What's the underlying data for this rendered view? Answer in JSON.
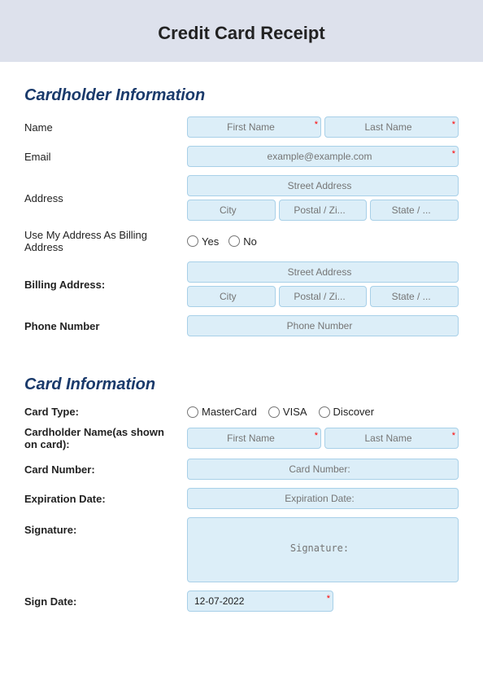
{
  "header": {
    "title": "Credit Card Receipt"
  },
  "cardholder_section": {
    "title": "Cardholder Information",
    "fields": {
      "name_label": "Name",
      "first_name_placeholder": "First Name",
      "last_name_placeholder": "Last Name",
      "email_label": "Email",
      "email_placeholder": "example@example.com",
      "address_label": "Address",
      "street_placeholder": "Street Address",
      "city_placeholder": "City",
      "postal_placeholder": "Postal / Zi...",
      "state_placeholder": "State / ...",
      "use_billing_label": "Use My Address As Billing Address",
      "yes_label": "Yes",
      "no_label": "No",
      "billing_label": "Billing Address:",
      "billing_street_placeholder": "Street Address",
      "billing_city_placeholder": "City",
      "billing_postal_placeholder": "Postal / Zi...",
      "billing_state_placeholder": "State / ...",
      "phone_label": "Phone Number",
      "phone_placeholder": "Phone Number"
    }
  },
  "card_section": {
    "title": "Card Information",
    "fields": {
      "card_type_label": "Card Type:",
      "card_options": [
        "MasterCard",
        "VISA",
        "Discover"
      ],
      "cardholder_name_label": "Cardholder Name(as shown on card):",
      "card_first_name_placeholder": "First Name",
      "card_last_name_placeholder": "Last Name",
      "card_number_label": "Card Number:",
      "card_number_placeholder": "Card Number:",
      "expiration_label": "Expiration Date:",
      "expiration_placeholder": "Expiration Date:",
      "signature_label": "Signature:",
      "signature_placeholder": "Signature:",
      "sign_date_label": "Sign Date:",
      "sign_date_value": "12-07-2022"
    }
  }
}
